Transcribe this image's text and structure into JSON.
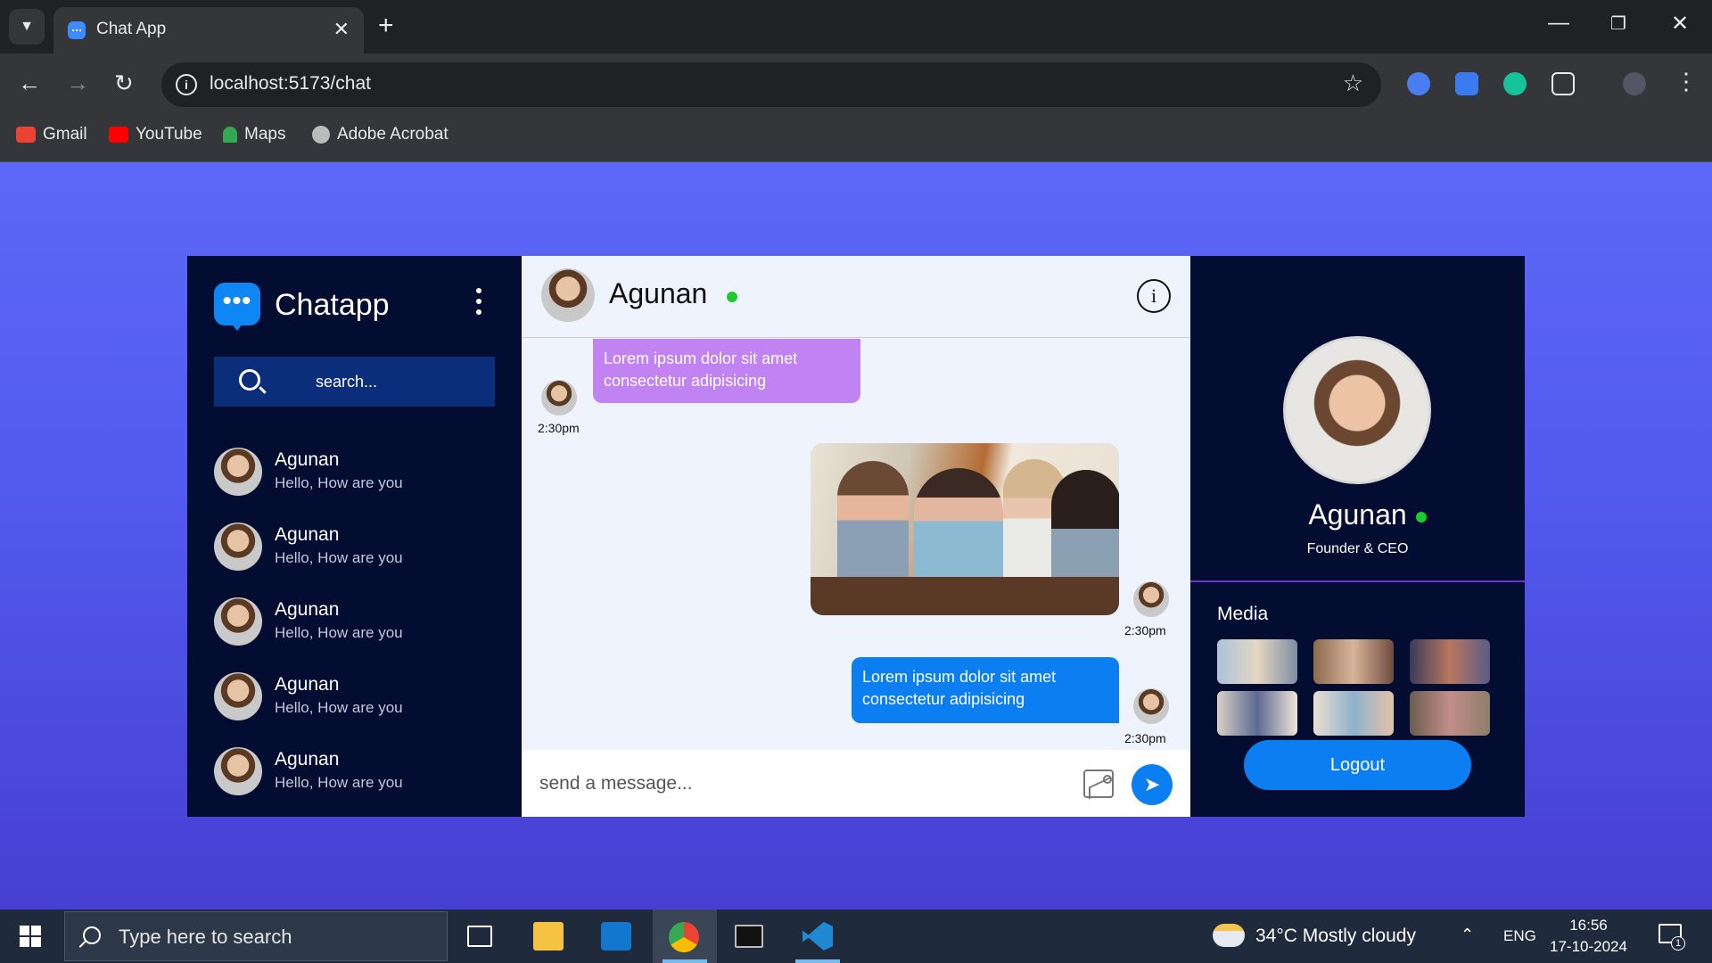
{
  "browser": {
    "tab_title": "Chat App",
    "url": "localhost:5173/chat",
    "bookmarks": [
      {
        "label": "Gmail",
        "icon": "gmail-icon",
        "color": "#ea4335"
      },
      {
        "label": "YouTube",
        "icon": "youtube-icon",
        "color": "#ff0000"
      },
      {
        "label": "Maps",
        "icon": "maps-icon",
        "color": "#34a853"
      },
      {
        "label": "Adobe Acrobat",
        "icon": "acrobat-icon",
        "color": "#bbbbbb"
      }
    ]
  },
  "sidebar": {
    "brand": "Chatapp",
    "search_placeholder": "search...",
    "contacts": [
      {
        "name": "Agunan",
        "message": "Hello, How are you"
      },
      {
        "name": "Agunan",
        "message": "Hello, How are you"
      },
      {
        "name": "Agunan",
        "message": "Hello, How are you"
      },
      {
        "name": "Agunan",
        "message": "Hello, How are you"
      },
      {
        "name": "Agunan",
        "message": "Hello, How are you"
      }
    ]
  },
  "chat": {
    "header_name": "Agunan",
    "messages": [
      {
        "side": "left",
        "text": "Lorem ipsum dolor sit amet consectetur adipisicing",
        "time": "2:30pm"
      },
      {
        "side": "right",
        "type": "image",
        "time": "2:30pm"
      },
      {
        "side": "right",
        "text": "Lorem ipsum dolor sit amet consectetur adipisicing",
        "time": "2:30pm"
      }
    ],
    "composer_placeholder": "send a message..."
  },
  "profile": {
    "name": "Agunan",
    "role": "Founder & CEO",
    "media_title": "Media",
    "logout_label": "Logout"
  },
  "taskbar": {
    "search_placeholder": "Type here to search",
    "weather": "34°C  Mostly cloudy",
    "language": "ENG",
    "time": "16:56",
    "date": "17-10-2024",
    "notification_count": "1"
  },
  "colors": {
    "accent_blue": "#0b7ff1",
    "bubble_purple": "#c182f2",
    "sidebar_bg": "#030c31",
    "online_green": "#1ccc2c"
  }
}
